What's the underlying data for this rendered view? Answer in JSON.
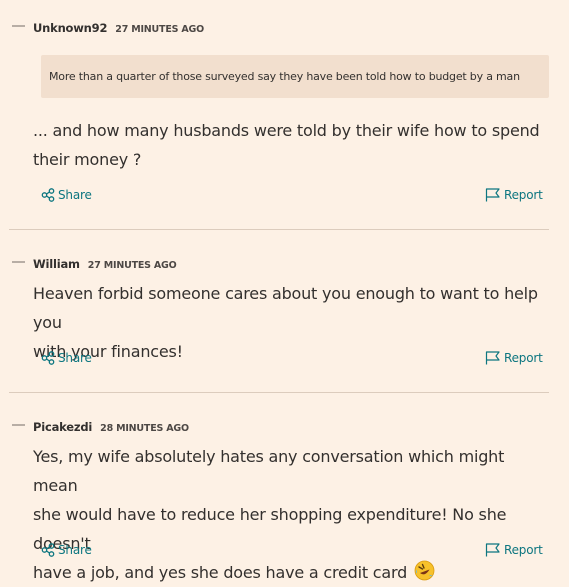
{
  "comments": [
    {
      "author": "Unknown92",
      "time": "27 MINUTES AGO",
      "quote": "More than a quarter of those surveyed say they have been told how to budget by a man",
      "text_line1": "... and how many husbands were told by their wife how to spend",
      "text_line2": "their money ?",
      "share_label": "Share",
      "report_label": "Report"
    },
    {
      "author": "William",
      "time": "27 MINUTES AGO",
      "text_line1": "Heaven forbid someone cares about you enough to want to help you",
      "text_line2": "with your finances!",
      "share_label": "Share",
      "report_label": "Report"
    },
    {
      "author": "Picakezdi",
      "time": "28 MINUTES AGO",
      "text_line1": "Yes, my wife absolutely hates any conversation which might mean",
      "text_line2": "she would have to reduce her shopping expenditure! No she doesn't",
      "text_line3": "have a job, and yes she does have a credit card",
      "emoji": "rolling-on-floor-laughing",
      "share_label": "Share",
      "report_label": "Report"
    }
  ],
  "colors": {
    "background": "#fdf1e5",
    "quote_background": "#f2dfce",
    "link": "#0d7680",
    "text": "#33302e"
  },
  "icons": [
    "collapse-icon",
    "share-icon",
    "flag-icon"
  ]
}
